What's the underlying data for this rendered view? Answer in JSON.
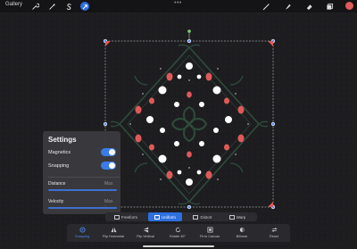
{
  "topbar": {
    "gallery_label": "Gallery",
    "left_tools": [
      "wrench-icon",
      "magic-wand-icon",
      "selection-s-icon",
      "transform-arrow-icon"
    ],
    "right_tools": [
      "brush-icon",
      "smudge-icon",
      "eraser-icon",
      "layers-icon"
    ],
    "more_label": "•••",
    "color_swatch": "#e05a5a"
  },
  "settings": {
    "title": "Settings",
    "magnetics_label": "Magnetics",
    "snapping_label": "Snapping",
    "distance_label": "Distance",
    "distance_max": "Max",
    "velocity_label": "Velocity",
    "velocity_max": "Max",
    "magnetics_on": true,
    "snapping_on": true,
    "distance_value_fraction": 1.0,
    "velocity_value_fraction": 1.0
  },
  "modes": [
    {
      "label": "Freeform",
      "icon": "freeform-icon",
      "active": false
    },
    {
      "label": "Uniform",
      "icon": "uniform-icon",
      "active": true
    },
    {
      "label": "Distort",
      "icon": "distort-icon",
      "active": false
    },
    {
      "label": "Warp",
      "icon": "warp-icon",
      "active": false
    }
  ],
  "bottom_actions": [
    {
      "label": "Snapping",
      "icon": "snapping-icon",
      "active": true
    },
    {
      "label": "Flip Horizontal",
      "icon": "flip-horizontal-icon",
      "active": false
    },
    {
      "label": "Flip Vertical",
      "icon": "flip-vertical-icon",
      "active": false
    },
    {
      "label": "Rotate 45°",
      "icon": "rotate-icon",
      "active": false
    },
    {
      "label": "Fit to Canvas",
      "icon": "fit-canvas-icon",
      "active": false
    },
    {
      "label": "Bilinear",
      "icon": "bilinear-icon",
      "active": false
    },
    {
      "label": "Reset",
      "icon": "reset-icon",
      "active": false
    }
  ],
  "colors": {
    "accent": "#2f6fe0",
    "toggle_on": "#3a7be8",
    "artwork_green": "#2f4b3a",
    "artwork_red": "#e0595a",
    "artwork_white": "#ffffff"
  }
}
